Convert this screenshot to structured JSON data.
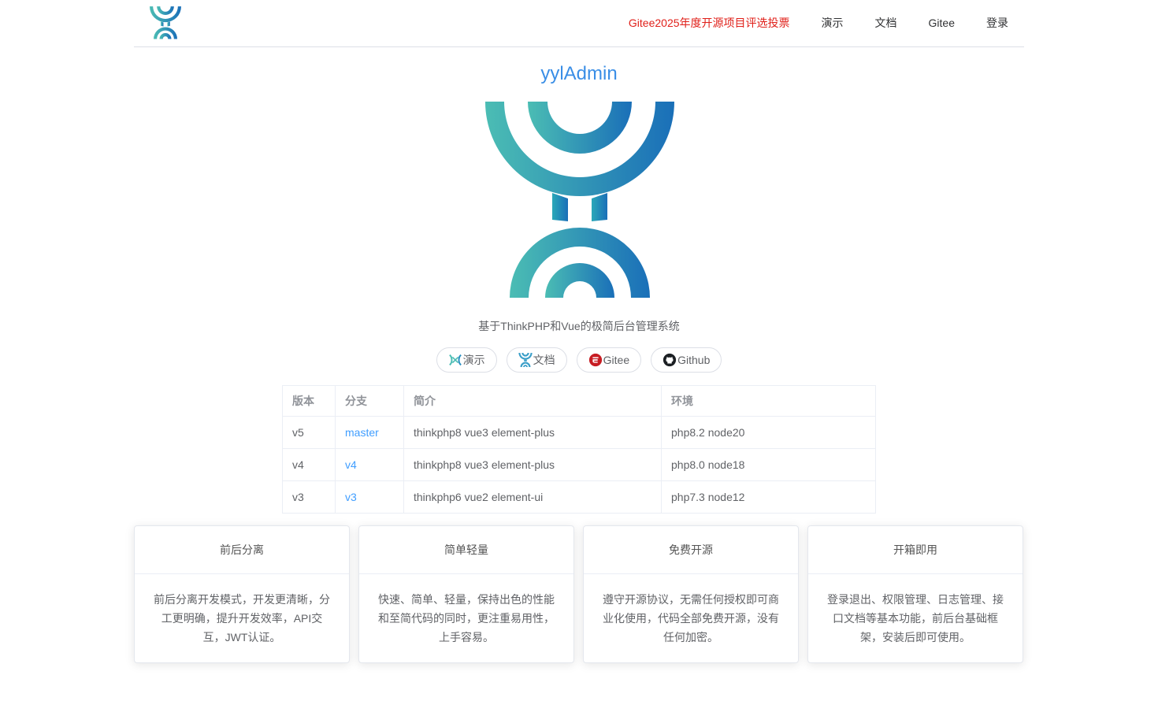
{
  "header": {
    "logo_name": "yylAdmin logo",
    "nav": [
      {
        "label": "Gitee2025年度开源项目评选投票",
        "color": "#e0201a"
      },
      {
        "label": "演示"
      },
      {
        "label": "文档"
      },
      {
        "label": "Gitee"
      },
      {
        "label": "登录"
      }
    ]
  },
  "hero": {
    "title": "yylAdmin",
    "subtitle": "基于ThinkPHP和Vue的极简后台管理系统"
  },
  "links": [
    {
      "label": "演示",
      "icon": "demo-icon"
    },
    {
      "label": "文档",
      "icon": "yyl-logo-icon"
    },
    {
      "label": "Gitee",
      "icon": "gitee-icon"
    },
    {
      "label": "Github",
      "icon": "github-icon"
    }
  ],
  "versions": {
    "headers": [
      "版本",
      "分支",
      "简介",
      "环境"
    ],
    "rows": [
      [
        "v5",
        "master",
        "thinkphp8 vue3 element-plus",
        "php8.2 node20"
      ],
      [
        "v4",
        "v4",
        "thinkphp8 vue3 element-plus",
        "php8.0 node18"
      ],
      [
        "v3",
        "v3",
        "thinkphp6 vue2 element-ui",
        "php7.3 node12"
      ]
    ]
  },
  "features": [
    {
      "title": "前后分离",
      "body": "前后分离开发模式，开发更清晰，分工更明确，提升开发效率，API交互，JWT认证。"
    },
    {
      "title": "简单轻量",
      "body": "快速、简单、轻量，保持出色的性能和至简代码的同时，更注重易用性，上手容易。"
    },
    {
      "title": "免费开源",
      "body": "遵守开源协议，无需任何授权即可商业化使用，代码全部免费开源，没有任何加密。"
    },
    {
      "title": "开箱即用",
      "body": "登录退出、权限管理、日志管理、接口文档等基本功能，前后台基础框架，安装后即可使用。"
    }
  ],
  "colors": {
    "accent": "#409eff",
    "vote": "#e0201a",
    "logo_start": "#4bbdb4",
    "logo_end": "#1a6fb8"
  }
}
